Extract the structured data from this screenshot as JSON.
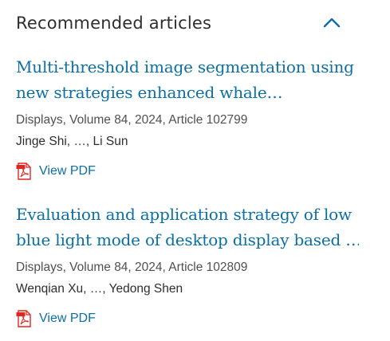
{
  "section": {
    "title": "Recommended articles",
    "collapse_icon": "chevron-up-icon"
  },
  "articles": [
    {
      "title_line1": "Multi-threshold image segmentation using",
      "title_line2": "new strategies enhanced whale…",
      "source": "Displays, Volume 84, 2024, Article 102799",
      "authors": "Jinge Shi, …, Li Sun",
      "pdf_label": "View PDF",
      "pdf_icon": "pdf-file-icon"
    },
    {
      "title_line1": "Evaluation and application strategy of low",
      "title_line2": "blue light mode of desktop display based …",
      "source": "Displays, Volume 84, 2024, Article 102809",
      "authors": "Wenqian Xu, …, Yedong Shen",
      "pdf_label": "View PDF",
      "pdf_icon": "pdf-file-icon"
    }
  ],
  "colors": {
    "link": "#0b6fa4",
    "heading": "#2e2e2e",
    "meta": "#505050",
    "pdf_red": "#e0271f"
  }
}
